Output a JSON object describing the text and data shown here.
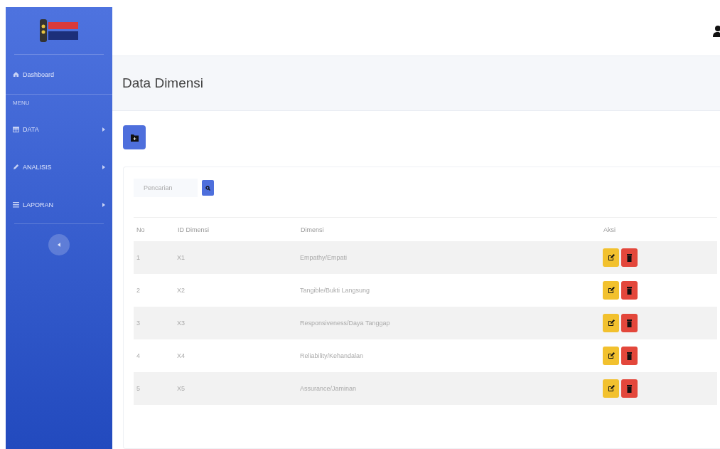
{
  "sidebar": {
    "items": [
      {
        "kind": "link",
        "label": "Dashboard"
      },
      {
        "kind": "heading",
        "label": "MENU"
      },
      {
        "kind": "menu",
        "label": "DATA"
      },
      {
        "kind": "menu",
        "label": "ANALISIS"
      },
      {
        "kind": "menu",
        "label": "LAPORAN"
      }
    ]
  },
  "page_title": "Data Dimensi",
  "search": {
    "placeholder": "Pencarian"
  },
  "table": {
    "columns": [
      "No",
      "ID Dimensi",
      "Dimensi",
      "Aksi"
    ],
    "rows": [
      {
        "no": "1",
        "id": "X1",
        "dimensi": "Empathy/Empati"
      },
      {
        "no": "2",
        "id": "X2",
        "dimensi": "Tangible/Bukti Langsung"
      },
      {
        "no": "3",
        "id": "X3",
        "dimensi": "Responsiveness/Daya Tanggap"
      },
      {
        "no": "4",
        "id": "X4",
        "dimensi": "Reliability/Kehandalan"
      },
      {
        "no": "5",
        "id": "X5",
        "dimensi": "Assurance/Jaminan"
      }
    ]
  }
}
